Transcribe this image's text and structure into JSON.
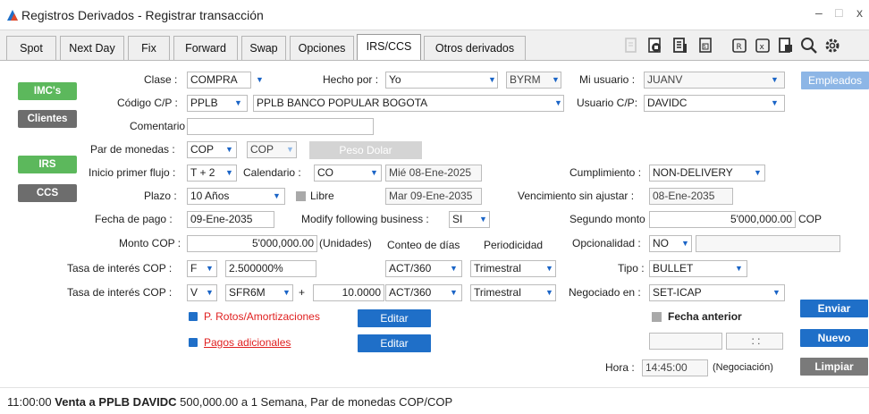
{
  "window": {
    "title": "Registros Derivados - Registrar transacción",
    "min": "–",
    "max": "□",
    "close": "x"
  },
  "tabs": [
    {
      "label": "Spot",
      "underline": "S",
      "rest": "pot"
    },
    {
      "label": "Next Day",
      "underline": "",
      "rest": "Next Day"
    },
    {
      "label": "Fix",
      "underline": "",
      "rest": "Fix"
    },
    {
      "label": "Forward",
      "underline": "F",
      "rest": "orward"
    },
    {
      "label": "Swap",
      "underline": "",
      "rest": "Swap"
    },
    {
      "label": "Opciones",
      "underline": "",
      "rest": "Opciones"
    },
    {
      "label": "IRS/CCS",
      "underline": "",
      "rest": "IRS/CCS"
    },
    {
      "label": "Otros derivados",
      "underline": "",
      "rest": "Otros derivados"
    }
  ],
  "side": {
    "imcs": "IMC's",
    "clientes": "Clientes",
    "irs": "IRS",
    "ccs": "CCS",
    "empleados": "Empleados"
  },
  "form": {
    "clase_label": "Clase :",
    "clase": "COMPRA",
    "hecho_label": "Hecho por :",
    "hecho": "Yo",
    "hecho_code": "BYRM",
    "mi_usuario_label": "Mi usuario :",
    "mi_usuario": "JUANV",
    "cp_label": "Código C/P :",
    "cp_code": "PPLB",
    "cp_name": "PPLB BANCO POPULAR  BOGOTA",
    "usuario_cp_label": "Usuario C/P:",
    "usuario_cp": "DAVIDC",
    "comentario_label": "Comentario :",
    "comentario": "",
    "par_label": "Par de monedas :",
    "par1": "COP",
    "par2": "COP",
    "peso_dolar": "Peso Dolar",
    "inicio_label": "Inicio primer flujo :",
    "inicio": "T + 2",
    "calendario_label": "Calendario :",
    "calendario": "CO",
    "fecha_inicio": "Mié 08-Ene-2025",
    "cumplimiento_label": "Cumplimiento :",
    "cumplimiento": "NON-DELIVERY",
    "plazo_label": "Plazo :",
    "plazo": "10 Años",
    "libre": "Libre",
    "fecha_fin": "Mar 09-Ene-2035",
    "venc_label": "Vencimiento sin ajustar :",
    "venc": "08-Ene-2035",
    "pago_label": "Fecha de pago :",
    "pago": "09-Ene-2035",
    "modify_label": "Modify following business :",
    "modify": "SI",
    "segundo_label": "Segundo monto :",
    "segundo": "5'000,000.00",
    "segundo_cur": "COP",
    "monto_label": "Monto COP :",
    "monto": "5'000,000.00",
    "unidades": "(Unidades)",
    "conteo_label": "Conteo de días",
    "periodicidad_label": "Periodicidad",
    "opcionalidad_label": "Opcionalidad :",
    "opcionalidad": "NO",
    "tasa1_label": "Tasa de interés COP :",
    "tasa1_tipo": "F",
    "tasa1_val": "2.500000%",
    "tasa1_conteo": "ACT/360",
    "tasa1_period": "Trimestral",
    "tipo_label": "Tipo :",
    "tipo": "BULLET",
    "tasa2_label": "Tasa de interés COP :",
    "tasa2_tipo": "V",
    "tasa2_idx": "SFR6M",
    "tasa2_plus": "+",
    "tasa2_val": "10.0000",
    "tasa2_conteo": "ACT/360",
    "tasa2_period": "Trimestral",
    "negociado_label": "Negociado en :",
    "negociado": "SET-ICAP",
    "rotos": "P. Rotos/Amortizaciones",
    "adicionales": "Pagos adicionales",
    "editar": "Editar",
    "fecha_anterior": "Fecha anterior",
    "hora_sep": ": :",
    "hora_label": "Hora :",
    "hora": "14:45:00",
    "negociacion": "(Negociación)",
    "enviar": "Enviar",
    "nuevo": "Nuevo",
    "limpiar": "Limpiar"
  },
  "status": {
    "time": "11:00:00",
    "bold": "Venta a PPLB DAVIDC",
    "rest": " 500,000.00 a 1 Semana, Par de monedas COP/COP"
  }
}
